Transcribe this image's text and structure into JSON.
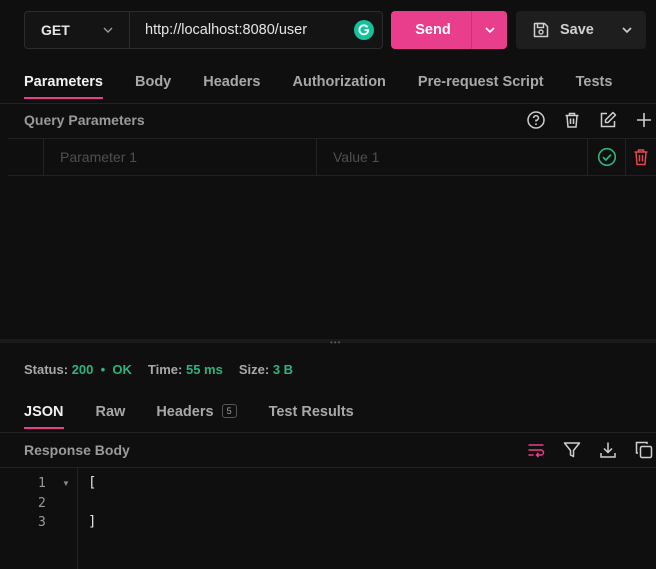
{
  "request": {
    "method": "GET",
    "url": "http://localhost:8080/user",
    "send_label": "Send",
    "save_label": "Save"
  },
  "request_tabs": [
    {
      "label": "Parameters",
      "active": true
    },
    {
      "label": "Body",
      "active": false
    },
    {
      "label": "Headers",
      "active": false
    },
    {
      "label": "Authorization",
      "active": false
    },
    {
      "label": "Pre-request Script",
      "active": false
    },
    {
      "label": "Tests",
      "active": false
    }
  ],
  "query_params": {
    "title": "Query Parameters",
    "row": {
      "key_placeholder": "Parameter 1",
      "value_placeholder": "Value 1"
    }
  },
  "status": {
    "status_label": "Status:",
    "status_code": "200",
    "status_sep": "•",
    "status_text": "OK",
    "time_label": "Time:",
    "time_value": "55 ms",
    "size_label": "Size:",
    "size_value": "3 B"
  },
  "response_tabs": [
    {
      "label": "JSON",
      "active": true
    },
    {
      "label": "Raw",
      "active": false
    },
    {
      "label": "Headers",
      "active": false,
      "badge": "5"
    },
    {
      "label": "Test Results",
      "active": false
    }
  ],
  "response_body": {
    "title": "Response Body",
    "lines": [
      {
        "num": "1",
        "text": "["
      },
      {
        "num": "2",
        "text": ""
      },
      {
        "num": "3",
        "text": "]"
      }
    ]
  },
  "colors": {
    "accent": "#e83e8c",
    "success": "#2fb37a",
    "danger": "#e5484d",
    "grammarly": "#15c39a"
  }
}
